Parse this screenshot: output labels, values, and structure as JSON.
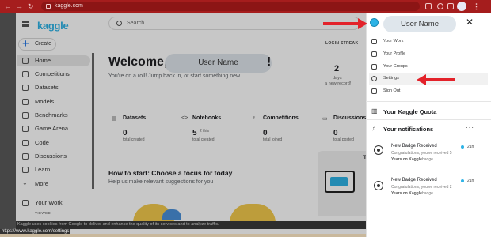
{
  "browser": {
    "url": "kaggle.com",
    "status_url": "https://www.kaggle.com/settings"
  },
  "app": {
    "logo": "kaggle",
    "create_label": "Create",
    "search_placeholder": "Search"
  },
  "sidebar": {
    "items": [
      {
        "label": "Home",
        "icon": "home-icon"
      },
      {
        "label": "Competitions",
        "icon": "trophy-icon"
      },
      {
        "label": "Datasets",
        "icon": "table-icon"
      },
      {
        "label": "Models",
        "icon": "models-icon"
      },
      {
        "label": "Benchmarks",
        "icon": "benchmark-icon"
      },
      {
        "label": "Game Arena",
        "icon": "game-icon"
      },
      {
        "label": "Code",
        "icon": "code-icon"
      },
      {
        "label": "Discussions",
        "icon": "comment-icon"
      },
      {
        "label": "Learn",
        "icon": "school-icon"
      },
      {
        "label": "More",
        "icon": "chevron-down-icon"
      }
    ],
    "your_work": "Your Work",
    "viewed": "VIEWED"
  },
  "main": {
    "welcome_prefix": "Welcome,",
    "user_name": "User Name",
    "welcome_suffix": "!",
    "subtitle": "You're on a roll! Jump back in, or start something new.",
    "streak_label": "LOGIN STREAK",
    "streak_value": "2",
    "streak_unit": "days",
    "streak_note": "a new record!",
    "stats": [
      {
        "title": "Datasets",
        "value": "0",
        "sub": "total created",
        "icon": "▤"
      },
      {
        "title": "Notebooks",
        "value": "5",
        "sub": "total created",
        "icon": "<>"
      },
      {
        "title": "Competitions",
        "value": "0",
        "sub": "total joined",
        "icon": "♆"
      },
      {
        "title": "Discussions",
        "value": "0",
        "sub": "total posted",
        "icon": "▭"
      }
    ],
    "notebooks_small": "2 this",
    "howto_title": "How to start: Choose a focus for today",
    "howto_sub": "Help us make relevant suggestions for you",
    "card_initial": "T"
  },
  "cookie_text": "Kaggle uses cookies from Google to deliver and enhance the quality of its services and to analyze traffic.",
  "panel": {
    "user_name": "User Name",
    "menu": [
      {
        "label": "Your Work",
        "icon": "edit-icon"
      },
      {
        "label": "Your Profile",
        "icon": "profile-icon"
      },
      {
        "label": "Your Groups",
        "icon": "groups-icon"
      },
      {
        "label": "Settings",
        "icon": "gear-icon"
      },
      {
        "label": "Sign Out",
        "icon": "sign-out-icon"
      }
    ],
    "quota_label": "Your Kaggle Quota",
    "notifications_label": "Your notifications",
    "notifications": [
      {
        "title": "New Badge Received",
        "body": "Congratulations, you've received 5",
        "body2": "Years on Kaggle",
        "body3": "badge",
        "time": "21h"
      },
      {
        "title": "New Badge Received",
        "body": "Congratulations, you've received 2",
        "body2": "Years on Kaggle",
        "body3": "badge",
        "time": "21h"
      }
    ]
  },
  "colors": {
    "chrome": "#a51d1d",
    "annotation_arrow": "#e3222a",
    "kaggle_blue": "#2db3e6",
    "name_pill": "#dfe6ec"
  }
}
